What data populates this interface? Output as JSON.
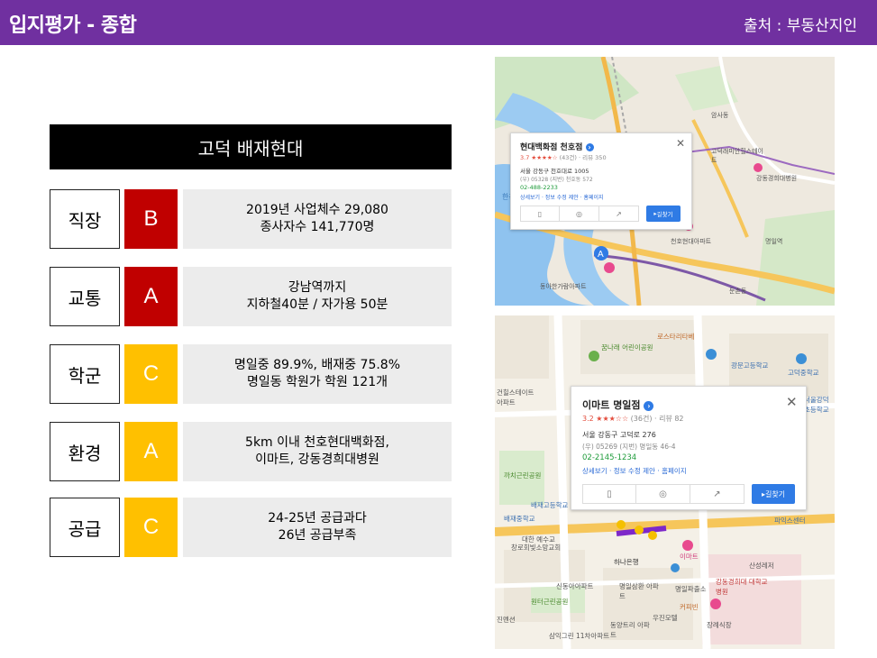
{
  "header": {
    "title": "입지평가 - 종합",
    "source": "출처 : 부동산지인"
  },
  "banner": {
    "title": "고덕 배재현대"
  },
  "rows": [
    {
      "category": "직장",
      "grade": "B",
      "grade_color": "#c00000",
      "lines": [
        "2019년 사업체수 29,080",
        "종사자수 141,770명"
      ]
    },
    {
      "category": "교통",
      "grade": "A",
      "grade_color": "#c00000",
      "lines": [
        "강남역까지",
        "지하철40분 / 자가용 50분"
      ]
    },
    {
      "category": "학군",
      "grade": "C",
      "grade_color": "#ffc000",
      "lines": [
        "명일중 89.9%, 배재중 75.8%",
        "명일동 학원가 학원 121개"
      ]
    },
    {
      "category": "환경",
      "grade": "A",
      "grade_color": "#ffc000",
      "lines": [
        "5km 이내 천호현대백화점,",
        "이마트, 강동경희대병원"
      ]
    },
    {
      "category": "공급",
      "grade": "C",
      "grade_color": "#ffc000",
      "lines": [
        "24-25년 공급과다",
        "26년 공급부족"
      ]
    }
  ],
  "map1": {
    "card": {
      "name": "현대백화점 천호점",
      "rating": "3.7 ★★★★☆",
      "rating_meta": "(43건) · 리뷰 350",
      "address": "서울 강동구 천호대로 1005",
      "sub_address": "(우) 05328 (지번) 천호동 572",
      "phone": "02-488-2233",
      "links": "상세보기 · 정보 수정 제안 · 홈페이지",
      "route_label": "길찾기"
    },
    "labels": [
      "고덕래미안힐스테이트",
      "천호현대아파트",
      "강동경희대병원",
      "암사동",
      "명일역",
      "둔촌동",
      "동아한가람아파트",
      "한강"
    ],
    "marker": "A"
  },
  "map2": {
    "card": {
      "name": "이마트 명일점",
      "rating": "3.2 ★★★☆☆",
      "rating_meta": "(36건) · 리뷰 82",
      "address": "서울 강동구 고덕로 276",
      "sub_address": "(우) 05269 (지번) 명일동 46-4",
      "phone": "02-2145-1234",
      "links": "상세보기 · 정보 수정 제안 · 홈페이지",
      "route_label": "길찾기"
    },
    "labels": [
      "로스타리타베",
      "꿈나래 어린이공원",
      "광문고등학교",
      "고덕중학교",
      "배재중학교",
      "배재고등학교",
      "하나은행",
      "이마트",
      "신동아아파트",
      "명일삼환 아파트",
      "명일파출소",
      "원터근린공원",
      "우진모텔",
      "커피빈",
      "강동경희대 대학교병원",
      "장례식장",
      "동양트리 아파트",
      "삼익그린 11차아파트",
      "산성레저",
      "파익스센터",
      "창로회빛소망교회",
      "대한 예수교",
      "까치근린공원",
      "건힐스테이트 아파트",
      "서울강덕 초등학교",
      "진멘션"
    ]
  }
}
